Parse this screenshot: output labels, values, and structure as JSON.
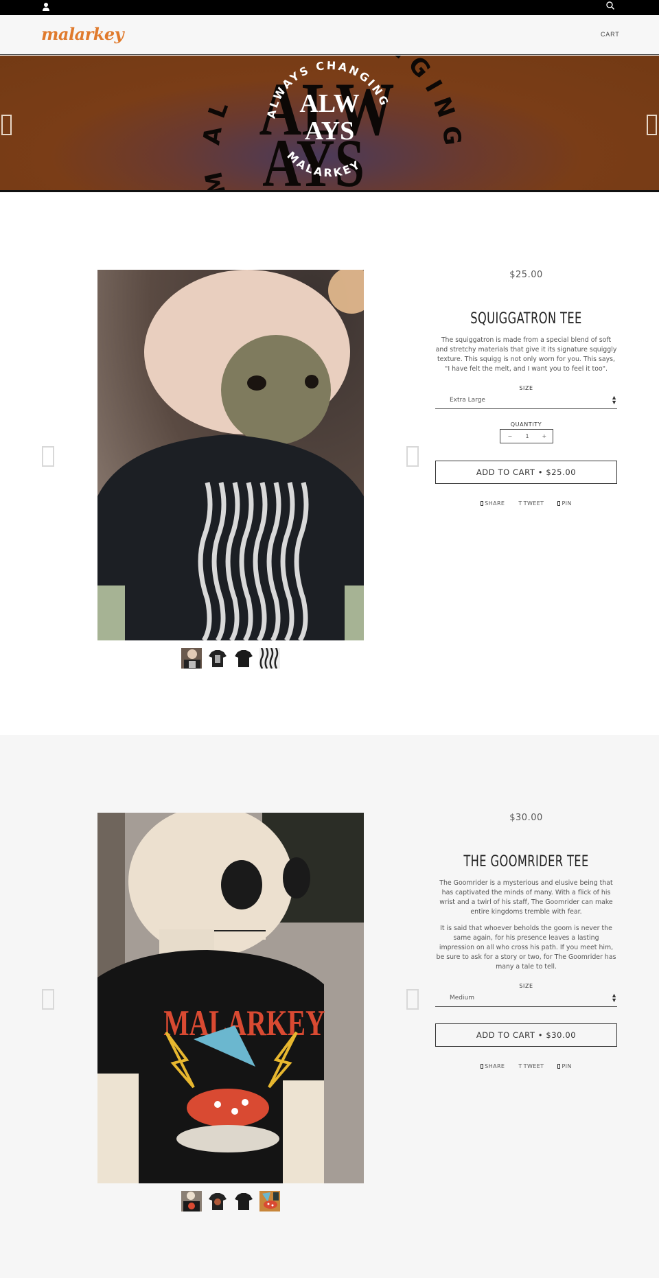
{
  "topbar": {
    "account_icon": "user-icon",
    "search_icon": "search-icon"
  },
  "header": {
    "logo": "malarkey",
    "cart_label": "CART",
    "brand_color": "#e07a2c"
  },
  "hero": {
    "center_words": [
      "ALW",
      "AYS"
    ],
    "ring_text_top": "ALWAYS CHANGING",
    "ring_text_bottom": "MALARKEY",
    "bg_words_left": "M AL",
    "bg_words_right": "NGING",
    "prev_icon": "chevron-left-icon",
    "next_icon": "chevron-right-icon"
  },
  "products": [
    {
      "price": "$25.00",
      "title": "SQUIGGATRON TEE",
      "description": [
        "The squiggatron is made from a special blend of soft and stretchy materials that give it its signature squiggly texture. This squigg is not only worn for you. This says, \"I have felt the melt, and I want you to feel it too\"."
      ],
      "size_label": "SIZE",
      "size_value": "Extra Large",
      "quantity_label": "QUANTITY",
      "quantity_minus": "−",
      "quantity_value": "1",
      "quantity_plus": "+",
      "add_to_cart": "ADD TO CART • $25.00",
      "share": "SHARE",
      "tweet": "TWEET",
      "pin": "PIN",
      "thumbnail_count": 4
    },
    {
      "price": "$30.00",
      "title": "THE GOOMRIDER TEE",
      "description": [
        "The Goomrider is a mysterious and elusive being that has captivated the minds of many. With a flick of his wrist and a twirl of his staff, The Goomrider can make entire kingdoms tremble with fear.",
        "It is said that whoever beholds the goom is never the same again, for his presence leaves a lasting impression on all who cross his path. If you meet him, be sure to ask for a story or two, for The Goomrider has many a tale to tell."
      ],
      "size_label": "SIZE",
      "size_value": "Medium",
      "add_to_cart": "ADD TO CART • $30.00",
      "share": "SHARE",
      "tweet": "TWEET",
      "pin": "PIN",
      "thumbnail_count": 4
    }
  ]
}
